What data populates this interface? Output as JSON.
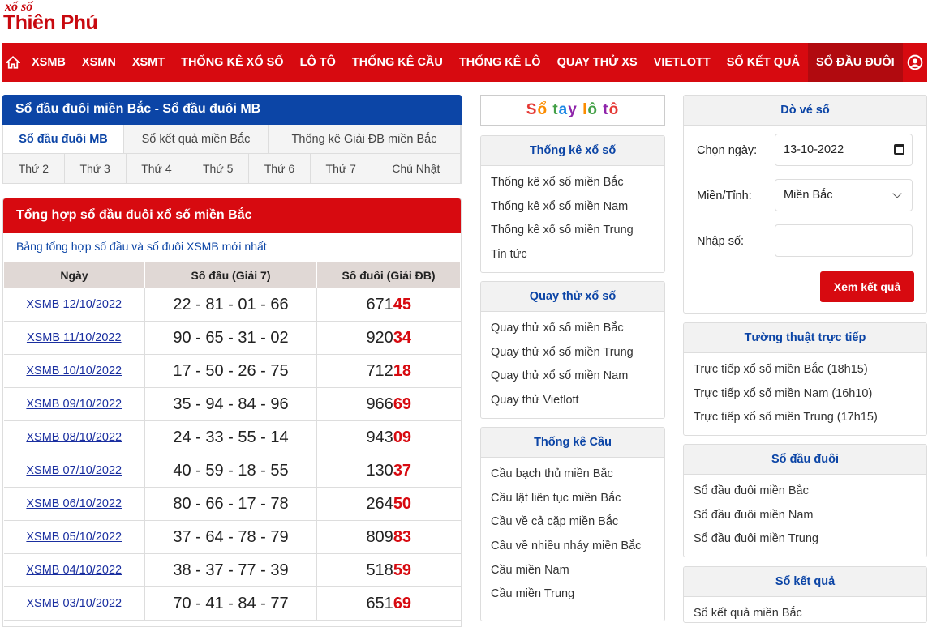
{
  "logo": {
    "line1": "xổ số",
    "line2": "Thiên Phú"
  },
  "nav": {
    "items": [
      "XSMB",
      "XSMN",
      "XSMT",
      "THỐNG KÊ XỔ SỐ",
      "LÔ TÔ",
      "THỐNG KÊ CẦU",
      "THỐNG KÊ LÔ",
      "QUAY THỬ XS",
      "VIETLOTT",
      "SỐ KẾT QUẢ",
      "SỔ ĐẦU ĐUÔI"
    ],
    "active": "SỔ ĐẦU ĐUÔI"
  },
  "breadcrumb": "Sổ đầu đuôi miền Bắc - Sổ đầu đuôi MB",
  "tabs1": [
    "Sổ đầu đuôi MB",
    "Sổ kết quả miền Bắc",
    "Thống kê Giải ĐB miền Bắc"
  ],
  "tabs2": [
    "Thứ 2",
    "Thứ 3",
    "Thứ 4",
    "Thứ 5",
    "Thứ 6",
    "Thứ 7",
    "Chủ Nhật"
  ],
  "card": {
    "title": "Tổng hợp sổ đầu đuôi xổ số miền Bắc",
    "subtitle": "Bảng tổng hợp số đầu và số đuôi XSMB mới nhất",
    "headers": [
      "Ngày",
      "Số đầu (Giải 7)",
      "Số đuôi (Giải ĐB)"
    ],
    "rows": [
      {
        "date": "XSMB 12/10/2022",
        "heads": "22 - 81 - 01 - 66",
        "tail_pre": "671",
        "tail_end": "45"
      },
      {
        "date": "XSMB 11/10/2022",
        "heads": "90 - 65 - 31 - 02",
        "tail_pre": "920",
        "tail_end": "34"
      },
      {
        "date": "XSMB 10/10/2022",
        "heads": "17 - 50 - 26 - 75",
        "tail_pre": "712",
        "tail_end": "18"
      },
      {
        "date": "XSMB 09/10/2022",
        "heads": "35 - 94 - 84 - 96",
        "tail_pre": "966",
        "tail_end": "69"
      },
      {
        "date": "XSMB 08/10/2022",
        "heads": "24 - 33 - 55 - 14",
        "tail_pre": "943",
        "tail_end": "09"
      },
      {
        "date": "XSMB 07/10/2022",
        "heads": "40 - 59 - 18 - 55",
        "tail_pre": "130",
        "tail_end": "37"
      },
      {
        "date": "XSMB 06/10/2022",
        "heads": "80 - 66 - 17 - 78",
        "tail_pre": "264",
        "tail_end": "50"
      },
      {
        "date": "XSMB 05/10/2022",
        "heads": "37 - 64 - 78 - 79",
        "tail_pre": "809",
        "tail_end": "83"
      },
      {
        "date": "XSMB 04/10/2022",
        "heads": "38 - 37 - 77 - 39",
        "tail_pre": "518",
        "tail_end": "59"
      },
      {
        "date": "XSMB 03/10/2022",
        "heads": "70 - 41 - 84 - 77",
        "tail_pre": "651",
        "tail_end": "69"
      }
    ]
  },
  "notebook": "Sổ tay lô tô",
  "stats": {
    "title": "Thống kê xổ số",
    "items": [
      "Thống kê xổ số miền Bắc",
      "Thống kê xổ số miền Nam",
      "Thống kê xổ số miền Trung",
      "Tin tức"
    ]
  },
  "trial": {
    "title": "Quay thử xổ số",
    "items": [
      "Quay thử xổ số miền Bắc",
      "Quay thử xổ số miền Trung",
      "Quay thử xổ số miền Nam",
      "Quay thử Vietlott"
    ]
  },
  "cau": {
    "title": "Thống kê Cầu",
    "items": [
      "Cầu bạch thủ miền Bắc",
      "Cầu lật liên tục miền Bắc",
      "Cầu về cả cặp miền Bắc",
      "Cầu về nhiều nháy miền Bắc",
      "Cầu miền Nam",
      "Cầu miền Trung"
    ]
  },
  "dove": {
    "title": "Dò vé số",
    "date_label": "Chọn ngày:",
    "date_value": "13-10-2022",
    "region_label": "Miền/Tỉnh:",
    "region_value": "Miền Bắc",
    "number_label": "Nhập số:",
    "submit": "Xem kết quả"
  },
  "live": {
    "title": "Tường thuật trực tiếp",
    "items": [
      "Trực tiếp xổ số miền Bắc (18h15)",
      "Trực tiếp xổ số miền Nam (16h10)",
      "Trực tiếp xổ số miền Trung (17h15)"
    ]
  },
  "sdd": {
    "title": "Sổ đầu đuôi",
    "items": [
      "Sổ đầu đuôi miền Bắc",
      "Sổ đầu đuôi miền Nam",
      "Sổ đầu đuôi miền Trung"
    ]
  },
  "skq": {
    "title": "Sổ kết quả",
    "items": [
      "Sổ kết quả miền Bắc"
    ]
  },
  "colors": {
    "brand_red": "#d70a10",
    "brand_blue": "#0c45a6"
  }
}
